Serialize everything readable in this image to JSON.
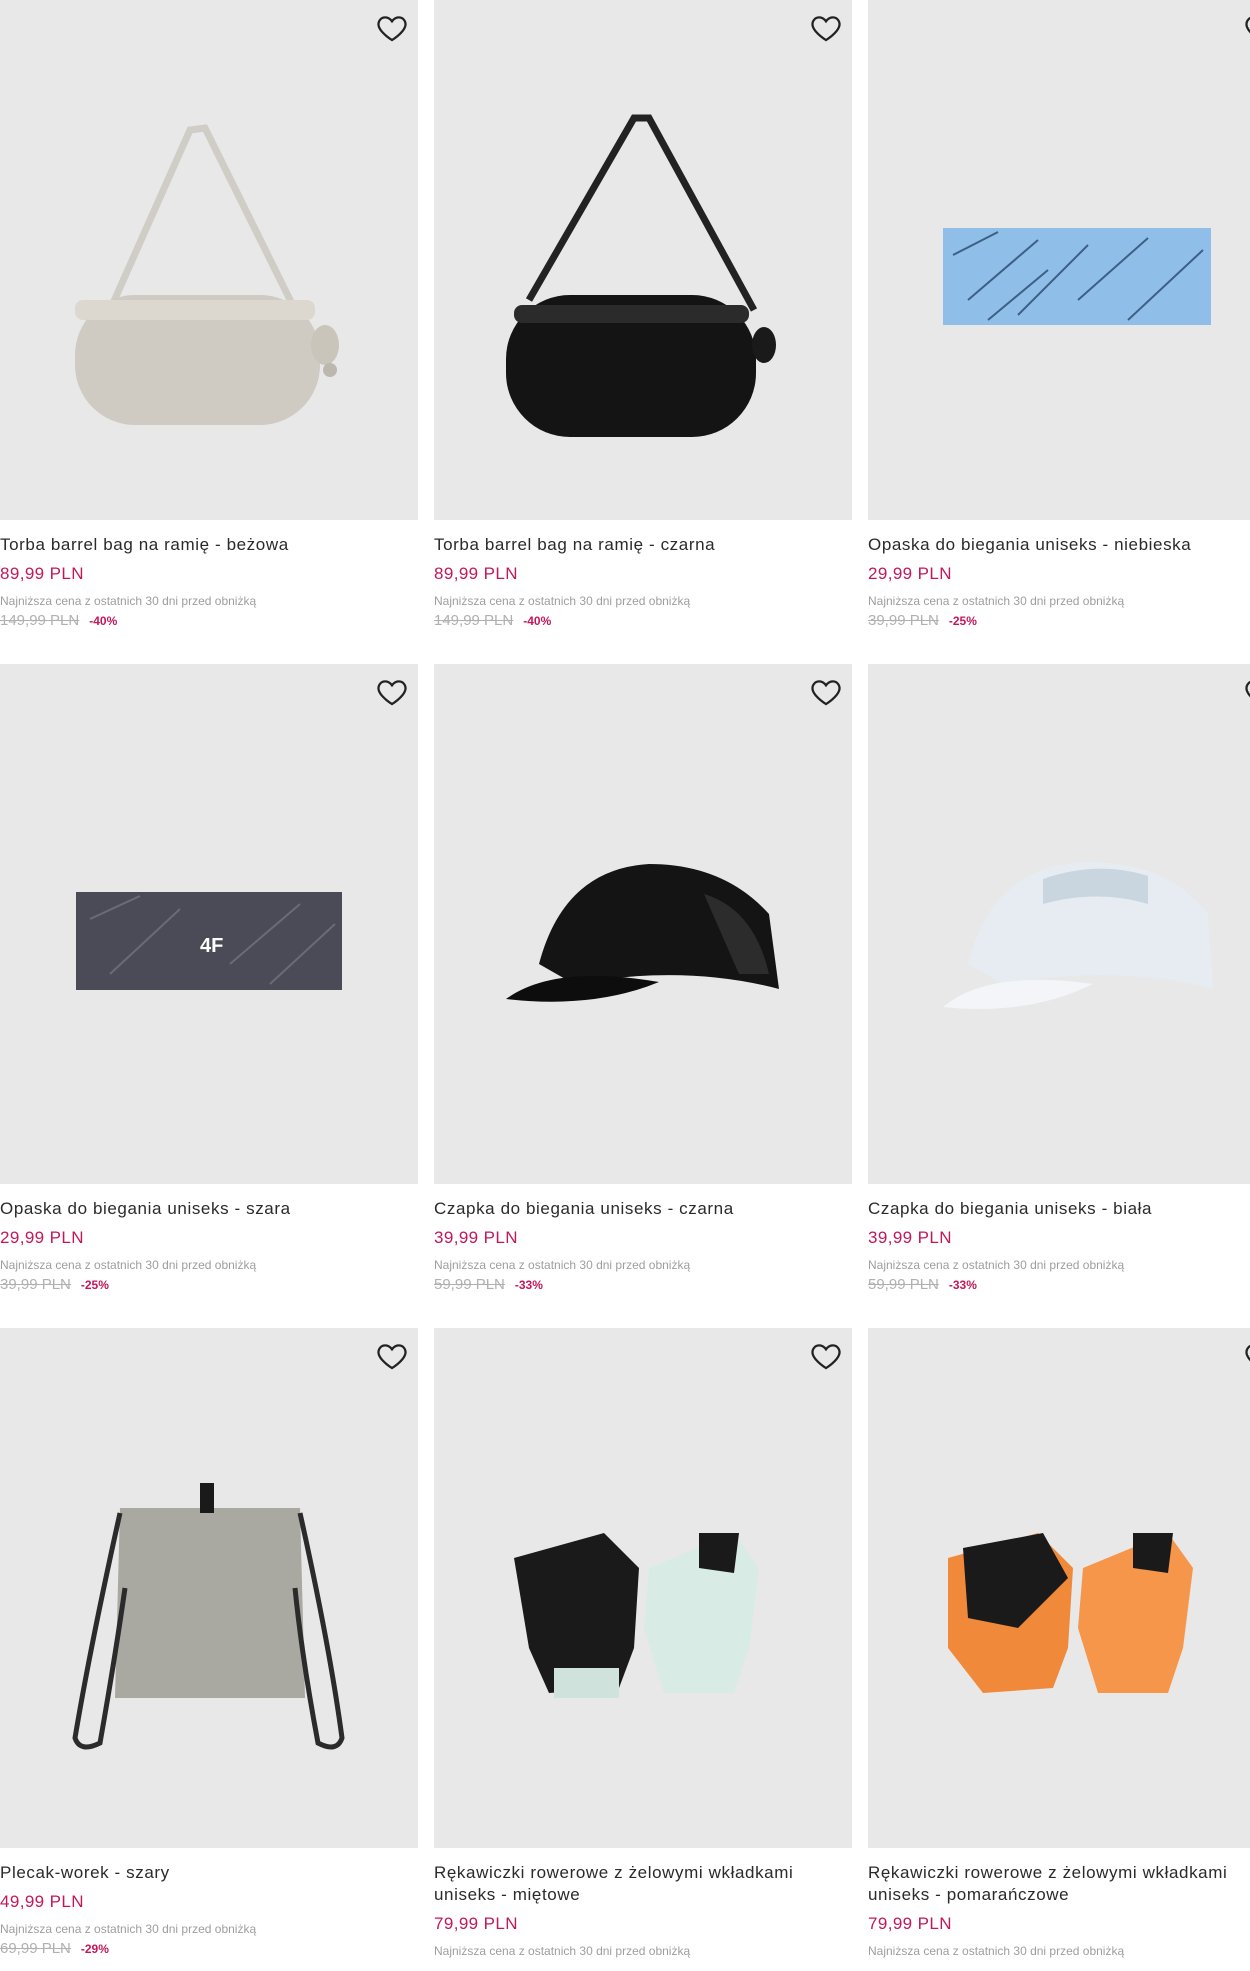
{
  "products": [
    {
      "title": "Torba barrel bag na ramię - beżowa",
      "price": "89,99 PLN",
      "lowest_note": "Najniższa cena z ostatnich 30 dni przed obniżką",
      "old_price": "149,99 PLN",
      "discount": "-40%",
      "image": "beige-barrel-bag"
    },
    {
      "title": "Torba barrel bag na ramię - czarna",
      "price": "89,99 PLN",
      "lowest_note": "Najniższa cena z ostatnich 30 dni przed obniżką",
      "old_price": "149,99 PLN",
      "discount": "-40%",
      "image": "black-barrel-bag"
    },
    {
      "title": "Opaska do biegania uniseks - niebieska",
      "price": "29,99 PLN",
      "lowest_note": "Najniższa cena z ostatnich 30 dni przed obniżką",
      "old_price": "39,99 PLN",
      "discount": "-25%",
      "image": "blue-headband"
    },
    {
      "title": "Opaska do biegania uniseks - szara",
      "price": "29,99 PLN",
      "lowest_note": "Najniższa cena z ostatnich 30 dni przed obniżką",
      "old_price": "39,99 PLN",
      "discount": "-25%",
      "image": "grey-headband",
      "logo_text": "4F"
    },
    {
      "title": "Czapka do biegania uniseks - czarna",
      "price": "39,99 PLN",
      "lowest_note": "Najniższa cena z ostatnich 30 dni przed obniżką",
      "old_price": "59,99 PLN",
      "discount": "-33%",
      "image": "black-cap"
    },
    {
      "title": "Czapka do biegania uniseks - biała",
      "price": "39,99 PLN",
      "lowest_note": "Najniższa cena z ostatnich 30 dni przed obniżką",
      "old_price": "59,99 PLN",
      "discount": "-33%",
      "image": "white-cap"
    },
    {
      "title": "Plecak-worek - szary",
      "price": "49,99 PLN",
      "lowest_note": "Najniższa cena z ostatnich 30 dni przed obniżką",
      "old_price": "69,99 PLN",
      "discount": "-29%",
      "image": "grey-drawstring-bag"
    },
    {
      "title": "Rękawiczki rowerowe z żelowymi wkładkami uniseks - miętowe",
      "price": "79,99 PLN",
      "lowest_note": "Najniższa cena z ostatnich 30 dni przed obniżką",
      "old_price": "",
      "discount": "",
      "image": "mint-cycling-gloves"
    },
    {
      "title": "Rękawiczki rowerowe z żelowymi wkładkami uniseks - pomarańczowe",
      "price": "79,99 PLN",
      "lowest_note": "Najniższa cena z ostatnich 30 dni przed obniżką",
      "old_price": "",
      "discount": "",
      "image": "orange-cycling-gloves"
    }
  ],
  "icons": {
    "favorite": "heart-outline-icon"
  },
  "colors": {
    "price": "#c2185b",
    "image_bg": "#e8e8e8"
  }
}
